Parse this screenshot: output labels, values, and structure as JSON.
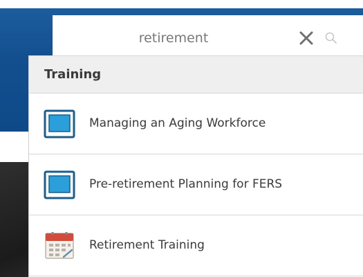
{
  "search": {
    "value": "retirement",
    "clear_icon": "close-icon",
    "search_icon": "search-icon"
  },
  "dropdown": {
    "section_title": "Training",
    "items": [
      {
        "label": "Managing an Aging Workforce",
        "icon": "computer-screen-icon"
      },
      {
        "label": "Pre-retirement Planning for FERS",
        "icon": "computer-screen-icon"
      },
      {
        "label": "Retirement Training",
        "icon": "calendar-icon"
      }
    ]
  },
  "colors": {
    "header_blue": "#134f8f",
    "screen_blue": "#2b9fd9",
    "screen_frame": "#1b5e8c",
    "calendar_red": "#d24b3c"
  }
}
